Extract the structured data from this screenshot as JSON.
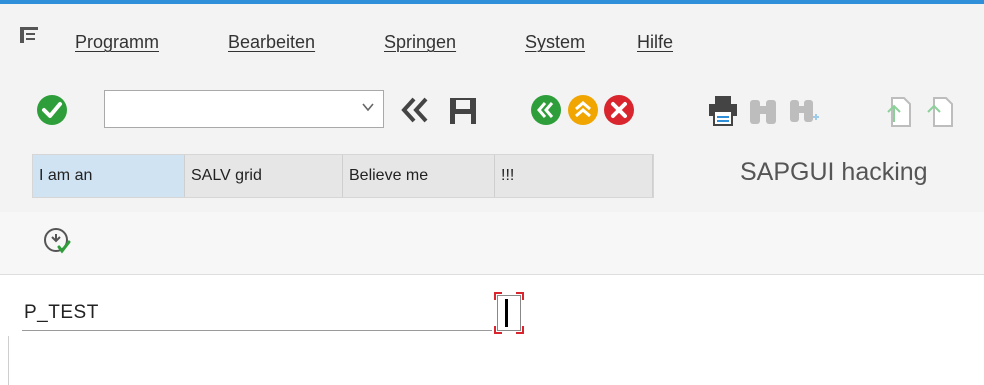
{
  "menubar": {
    "icon": "menu-icon",
    "items": [
      {
        "label": "Programm"
      },
      {
        "label": "Bearbeiten"
      },
      {
        "label": "Springen"
      },
      {
        "label": "System"
      },
      {
        "label": "Hilfe"
      }
    ]
  },
  "toolbar": {
    "command_field": {
      "value": "",
      "placeholder": ""
    },
    "icons": [
      "enter-icon",
      "dropdown-arrow-icon",
      "back-double-arrow-icon",
      "save-icon",
      "back-icon",
      "exit-icon",
      "cancel-icon",
      "print-icon",
      "find-icon",
      "find-next-icon",
      "first-page-icon",
      "previous-page-icon"
    ]
  },
  "header_grid": {
    "cells": [
      "I am an",
      "SALV grid",
      "Believe me",
      "!!!"
    ]
  },
  "screen_title": "SAPGUI hacking",
  "app_toolbar": {
    "icons": [
      "execute-icon"
    ]
  },
  "selection": {
    "field_label": "P_TEST",
    "field_value": ""
  },
  "colors": {
    "accent_top": "#2f8fd8",
    "enter_green": "#2e9e3a",
    "back_green": "#2e9e3a",
    "exit_orange": "#f0a500",
    "cancel_red": "#d9262e",
    "selected_cell": "#cfe3f3"
  }
}
